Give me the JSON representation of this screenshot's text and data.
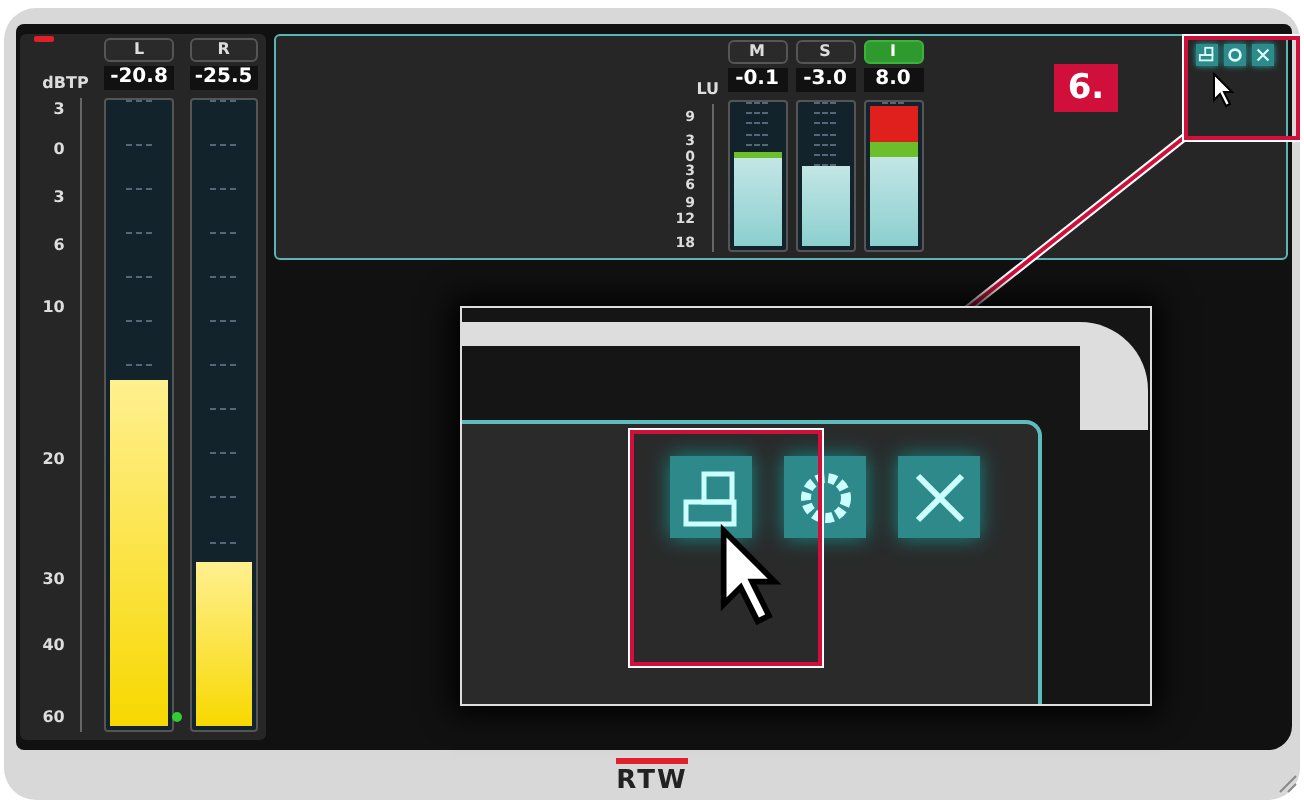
{
  "true_peak_meter": {
    "unit": "dBTP",
    "scale": [
      "3",
      "0",
      "3",
      "6",
      "10",
      "20",
      "30",
      "40",
      "60"
    ],
    "channels": [
      {
        "name": "L",
        "reading": "-20.8",
        "level": 0.55
      },
      {
        "name": "R",
        "reading": "-25.5",
        "level": 0.26
      }
    ]
  },
  "loudness_meter": {
    "unit": "LU",
    "scale": [
      "9",
      "3",
      "0",
      "3",
      "6",
      "9",
      "12",
      "18"
    ],
    "channels": [
      {
        "name": "M",
        "reading": "-0.1",
        "level": 0.64,
        "selected": false
      },
      {
        "name": "S",
        "reading": "-3.0",
        "level": 0.54,
        "selected": false
      },
      {
        "name": "I",
        "reading": "8.0",
        "level": 0.94,
        "selected": true
      }
    ]
  },
  "callout": {
    "label": "6."
  },
  "logo": "RTW"
}
